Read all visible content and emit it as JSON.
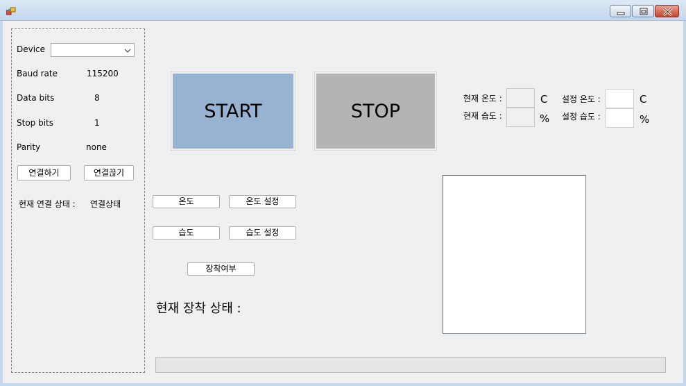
{
  "window": {
    "title": ""
  },
  "serial": {
    "device_label": "Device",
    "device_value": "",
    "baud_label": "Baud rate",
    "baud_value": "115200",
    "databits_label": "Data bits",
    "databits_value": "8",
    "stopbits_label": "Stop bits",
    "stopbits_value": "1",
    "parity_label": "Parity",
    "parity_value": "none",
    "connect_label": "연결하기",
    "disconnect_label": "연결끊기",
    "status_label": "현재 연결 상태 :",
    "status_value": "연결상태"
  },
  "controls": {
    "start_label": "START",
    "stop_label": "STOP",
    "temp_button": "온도",
    "temp_set_button": "온도 설정",
    "hum_button": "습도",
    "hum_set_button": "습도 설정",
    "wear_button": "장착여부",
    "wear_status_label": "현재 장착 상태 :"
  },
  "readings": {
    "cur_temp_label": "현재 온도 :",
    "cur_temp_value": "",
    "temp_unit": "C",
    "cur_hum_label": "현재 습도 :",
    "cur_hum_value": "",
    "hum_unit": "%",
    "set_temp_label": "설정 온도 :",
    "set_temp_value": "",
    "set_hum_label": "설정 습도 :",
    "set_hum_value": ""
  },
  "progress": {
    "value": 0
  },
  "colors": {
    "start_bg": "#98b3d2",
    "stop_bg": "#b4b4b4"
  },
  "icons": {
    "app": "app-icon",
    "minimize": "minimize-icon",
    "maximize": "maximize-icon",
    "close": "close-icon",
    "dropdown": "chevron-down-icon"
  }
}
